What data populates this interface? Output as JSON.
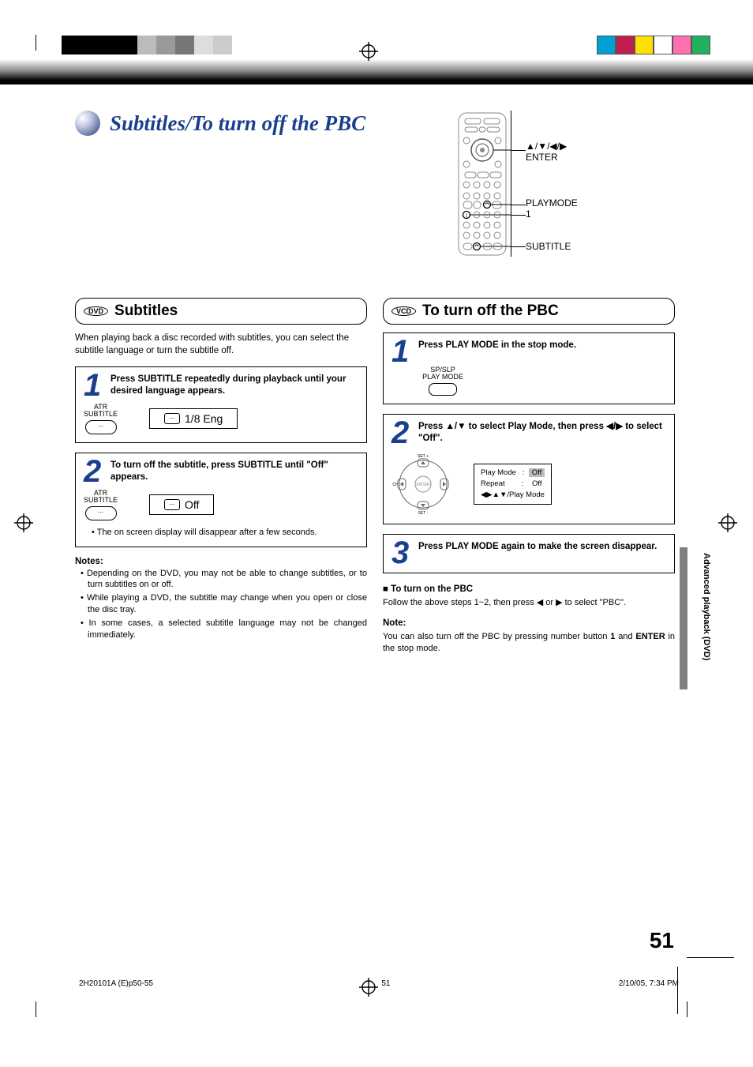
{
  "mainTitle": "Subtitles/To turn off the PBC",
  "remote": {
    "labels": {
      "arrows": "▲/▼/◀/▶",
      "enter": "ENTER",
      "playmode": "PLAYMODE",
      "one": "1",
      "subtitle": "SUBTITLE"
    }
  },
  "left": {
    "badge": "DVD",
    "header": "Subtitles",
    "intro": "When playing back a disc recorded with subtitles, you can select the subtitle language or turn the subtitle off.",
    "step1": {
      "text": "Press SUBTITLE repeatedly during playback until your desired language appears.",
      "btnTop": "ATR",
      "btnBot": "SUBTITLE",
      "osd": "1/8 Eng"
    },
    "step2": {
      "text": "To turn off the subtitle, press SUBTITLE until \"Off\" appears.",
      "btnTop": "ATR",
      "btnBot": "SUBTITLE",
      "osd": "Off",
      "afternote": "The on screen display will disappear after a few seconds."
    },
    "notesHead": "Notes:",
    "notes": [
      "Depending on the DVD, you may not be able to change subtitles, or to turn subtitles on or off.",
      "While playing a DVD, the subtitle may change when you open or close the disc tray.",
      "In some cases, a selected subtitle language may not be changed immediately."
    ]
  },
  "right": {
    "badge": "VCD",
    "header": "To turn off the PBC",
    "step1": {
      "text": "Press PLAY MODE in the stop mode.",
      "lbl1": "SP/SLP",
      "lbl2": "PLAY MODE"
    },
    "step2": {
      "text": "Press ▲/▼ to select Play Mode, then press ◀/▶ to select \"Off\".",
      "menu": {
        "r1a": "Play Mode",
        "r1b": ":",
        "r1c": "Off",
        "r2a": "Repeat",
        "r2b": ":",
        "r2c": "Off",
        "r3": "◀▶▲▼/Play Mode"
      }
    },
    "step3": {
      "text": "Press PLAY MODE again to make the screen disappear."
    },
    "turnOnHead": "To turn on the PBC",
    "turnOnBody": "Follow the above steps 1~2, then press ◀ or ▶ to select \"PBC\".",
    "noteHead": "Note:",
    "noteBody1": "You can also turn off the PBC by pressing number button ",
    "noteBody1b": "1",
    "noteBody2": " and ",
    "noteBody2b": "ENTER",
    "noteBody3": " in the stop mode."
  },
  "tab": "Advanced playback (DVD)",
  "pageNum": "51",
  "footer": {
    "left": "2H20101A (E)p50-55",
    "mid": "51",
    "right": "2/10/05, 7:34 PM"
  }
}
